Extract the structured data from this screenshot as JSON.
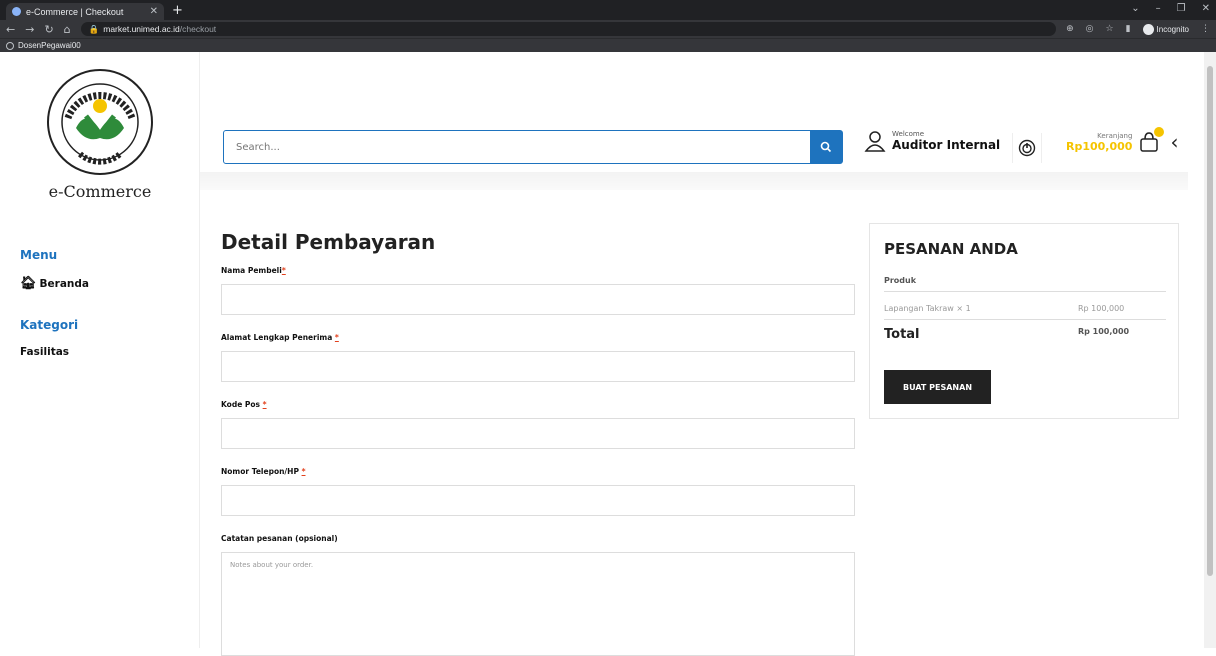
{
  "browser": {
    "tab_title": "e-Commerce | Checkout",
    "url_host": "market.unimed.ac.id",
    "url_path": "/checkout",
    "incognito_label": "Incognito",
    "bookmark": "DosenPegawai00"
  },
  "sidebar": {
    "brand": "e-Commerce",
    "menu_heading": "Menu",
    "home_label": "Beranda",
    "category_heading": "Kategori",
    "category_item": "Fasilitas"
  },
  "header": {
    "search_placeholder": "Search...",
    "welcome": "Welcome",
    "user_name": "Auditor Internal",
    "cart_label": "Keranjang",
    "cart_amount": "Rp100,000"
  },
  "form": {
    "title": "Detail Pembayaran",
    "name_label": "Nama Pembeli",
    "address_label": "Alamat Lengkap Penerima ",
    "postal_label": "Kode Pos ",
    "phone_label": "Nomor Telepon/HP ",
    "notes_label": "Catatan pesanan (opsional)",
    "notes_placeholder": "Notes about your order.",
    "required_mark": "*"
  },
  "order": {
    "title": "PESANAN ANDA",
    "col_product": "Produk",
    "item_name": "Lapangan Takraw × 1",
    "item_price": "Rp 100,000",
    "total_label": "Total",
    "total_price": "Rp 100,000",
    "button": "BUAT PESANAN"
  },
  "colors": {
    "accent": "#1e73be",
    "price": "#f5c400",
    "button": "#222222"
  }
}
